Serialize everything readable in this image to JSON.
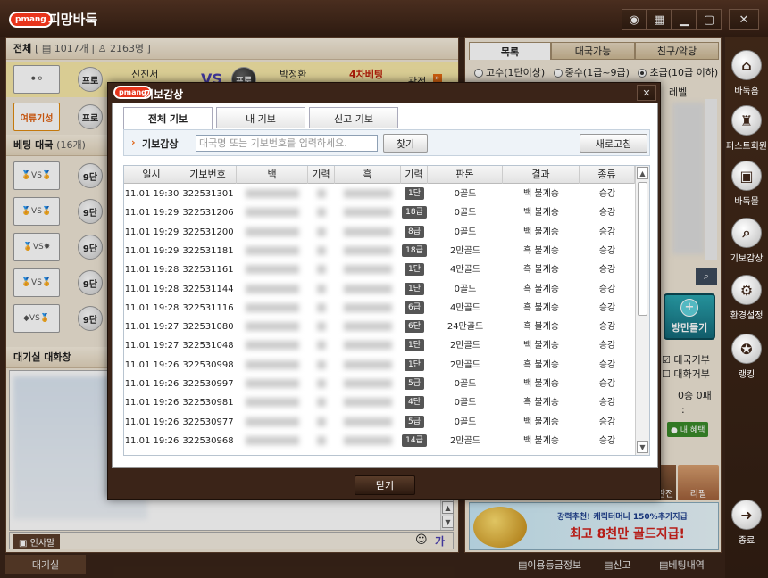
{
  "app": {
    "logo": "pmang",
    "title": "피망바둑"
  },
  "left": {
    "all_label": "전체",
    "all_stats": "[ ▤ 1017개 | ♙ 2163명 ]",
    "featured": {
      "left_player": "신진서",
      "right_player": "박정환",
      "vs": "VS",
      "left_rank": "프로",
      "right_rank": "프로",
      "tag": "4차베팅",
      "state": "관전"
    },
    "second_row": {
      "icon_label": "여류기성",
      "rank": "프로"
    },
    "betting_header": "베팅 대국",
    "betting_count": "(16개)",
    "betting_ranks": [
      "9단",
      "9단",
      "9단",
      "9단",
      "9단"
    ],
    "chat_title": "대기실 대화창",
    "chat_input_label": "인사말"
  },
  "bottom": {
    "waiting_tab": "대기실",
    "links": [
      "이용등급정보",
      "신고",
      "베팅내역"
    ]
  },
  "right": {
    "tabs": [
      "목록",
      "대국가능",
      "친구/악당"
    ],
    "radios": [
      "고수(1단이상)",
      "중수(1급~9급)",
      "초급(10급 이하)"
    ],
    "col_level": "레벨",
    "make_room": "방만들기",
    "check1": "대국거부",
    "check2": "대화거부",
    "record": "0승 0패",
    "record_sep": ":",
    "benefit": "● 내 혜택",
    "bottom_btn1": "관전사",
    "bottom_btn2": "리필",
    "banner_line1": "강력추천! 캐릭터머니 150%추가지급",
    "banner_line2": "최고 8천만 골드지급!"
  },
  "sidebar": [
    "바둑홈",
    "퍼스트회원",
    "바둑몰",
    "기보감상",
    "환경설정",
    "랭킹",
    "종료"
  ],
  "modal": {
    "title": "기보감상",
    "tabs": [
      "전체 기보",
      "내 기보",
      "신고 기보"
    ],
    "search_label": "기보감상",
    "search_placeholder": "대국명 또는 기보번호를 입력하세요.",
    "search_button": "찾기",
    "refresh_button": "새로고침",
    "close_button": "닫기",
    "columns": [
      "일시",
      "기보번호",
      "백",
      "기력",
      "흑",
      "기력",
      "판돈",
      "결과",
      "종류"
    ],
    "rows": [
      {
        "time": "11.01 19:30",
        "no": "322531301",
        "rank": "1단",
        "stake": "0골드",
        "result": "백 불계승",
        "kind": "승강"
      },
      {
        "time": "11.01 19:29",
        "no": "322531206",
        "rank": "18급",
        "stake": "0골드",
        "result": "백 불계승",
        "kind": "승강"
      },
      {
        "time": "11.01 19:29",
        "no": "322531200",
        "rank": "8급",
        "stake": "0골드",
        "result": "백 불계승",
        "kind": "승강"
      },
      {
        "time": "11.01 19:29",
        "no": "322531181",
        "rank": "18급",
        "stake": "2만골드",
        "result": "흑 불계승",
        "kind": "승강"
      },
      {
        "time": "11.01 19:28",
        "no": "322531161",
        "rank": "1단",
        "stake": "4만골드",
        "result": "흑 불계승",
        "kind": "승강"
      },
      {
        "time": "11.01 19:28",
        "no": "322531144",
        "rank": "1단",
        "stake": "0골드",
        "result": "흑 불계승",
        "kind": "승강"
      },
      {
        "time": "11.01 19:28",
        "no": "322531116",
        "rank": "6급",
        "stake": "4만골드",
        "result": "흑 불계승",
        "kind": "승강"
      },
      {
        "time": "11.01 19:27",
        "no": "322531080",
        "rank": "6단",
        "stake": "24만골드",
        "result": "흑 불계승",
        "kind": "승강"
      },
      {
        "time": "11.01 19:27",
        "no": "322531048",
        "rank": "1단",
        "stake": "2만골드",
        "result": "백 불계승",
        "kind": "승강"
      },
      {
        "time": "11.01 19:26",
        "no": "322530998",
        "rank": "1단",
        "stake": "2만골드",
        "result": "흑 불계승",
        "kind": "승강"
      },
      {
        "time": "11.01 19:26",
        "no": "322530997",
        "rank": "5급",
        "stake": "0골드",
        "result": "백 불계승",
        "kind": "승강"
      },
      {
        "time": "11.01 19:26",
        "no": "322530981",
        "rank": "4단",
        "stake": "0골드",
        "result": "흑 불계승",
        "kind": "승강"
      },
      {
        "time": "11.01 19:26",
        "no": "322530977",
        "rank": "5급",
        "stake": "0골드",
        "result": "백 불계승",
        "kind": "승강"
      },
      {
        "time": "11.01 19:26",
        "no": "322530968",
        "rank": "14급",
        "stake": "2만골드",
        "result": "백 불계승",
        "kind": "승강"
      }
    ]
  }
}
